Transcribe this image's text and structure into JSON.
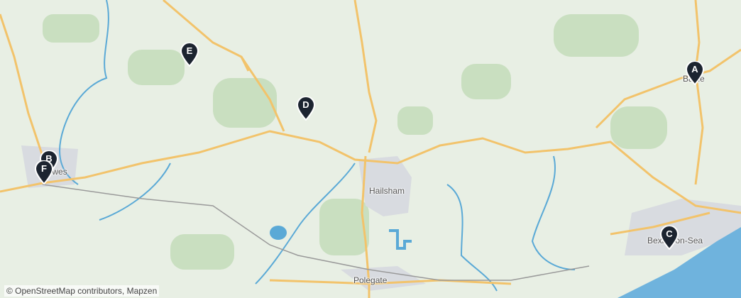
{
  "map": {
    "places": [
      {
        "id": "hailsham",
        "name": "Hailsham"
      },
      {
        "id": "polegate",
        "name": "Polegate"
      },
      {
        "id": "bexhill",
        "name": "Bexhill-on-Sea"
      },
      {
        "id": "lewes",
        "name": "Lewes"
      },
      {
        "id": "battle",
        "name": "Battle"
      }
    ],
    "markers": [
      {
        "id": "a",
        "label": "A",
        "color": "#1c2430"
      },
      {
        "id": "b",
        "label": "B",
        "color": "#1c2430"
      },
      {
        "id": "c",
        "label": "C",
        "color": "#1c2430"
      },
      {
        "id": "d",
        "label": "D",
        "color": "#1c2430"
      },
      {
        "id": "e",
        "label": "E",
        "color": "#1c2430"
      },
      {
        "id": "f",
        "label": "F",
        "color": "#1c2430"
      }
    ],
    "attribution": "© OpenStreetMap contributors, Mapzen",
    "colors": {
      "land": "#e8efe4",
      "forest": "#c9dfc0",
      "water": "#5aa9d6",
      "sea": "#6fb3dd",
      "road": "#f2c36b",
      "urban": "#d8dbe0"
    }
  }
}
